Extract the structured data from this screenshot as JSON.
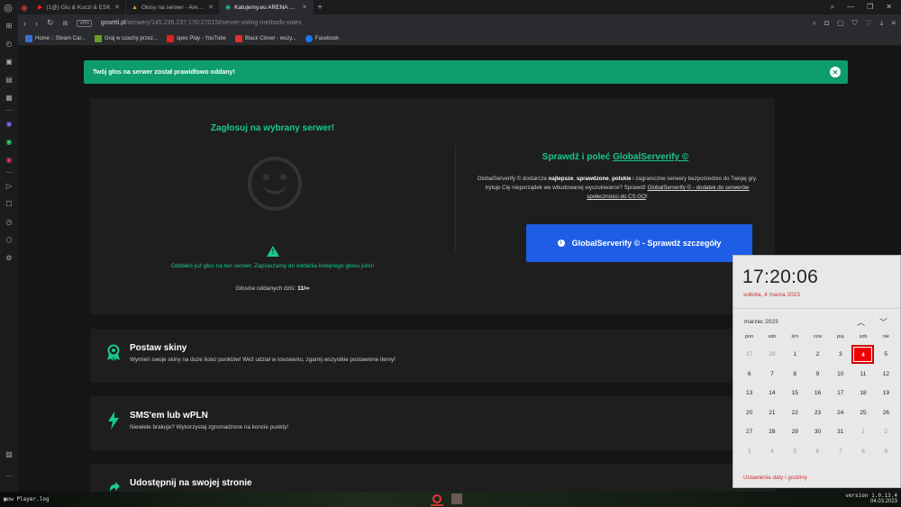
{
  "browser": {
    "tabs": [
      {
        "title": "(1@) Giu & Kuczi & ESK",
        "active": false
      },
      {
        "title": "Głosy na serwer - Arena 1v",
        "active": false
      },
      {
        "title": "Katujemy.eu ARENA 1v1 1",
        "active": true
      }
    ],
    "url_domain": "gosetti.pl",
    "url_path": "/serwery/145.239.237.170:27015#server-voting-methods-votes",
    "vpn_label": "VPN",
    "bookmarks": [
      {
        "label": "Home :: Steam Car...",
        "color": "#3a6fd1"
      },
      {
        "label": "Graj w szachy przez...",
        "color": "#6a9a2a"
      },
      {
        "label": "spec Play - YouTube",
        "color": "#e02020"
      },
      {
        "label": "Black Clover - wszy...",
        "color": "#e03030"
      },
      {
        "label": "Facebook",
        "color": "#1877f2"
      }
    ]
  },
  "alert": {
    "message": "Twój głos na serwer został prawidłowo oddany!",
    "close_glyph": "✕"
  },
  "vote_card": {
    "title": "Zagłosuj na wybrany serwer!",
    "voted_message": "Oddałeś już głos na ten serwer. Zapraszamy do oddania kolejnego głosu jutro!",
    "votes_label": "Głosów oddanych dziś:",
    "votes_value": "11/∞",
    "gs_title_prefix": "Sprawdź i poleć",
    "gs_title_link": "GlobalServerify ©",
    "gs_desc_1": "GlobalServerify © dostarcza",
    "gs_desc_b1": "najlepsze",
    "gs_desc_sep1": ",",
    "gs_desc_b2": "sprawdzone",
    "gs_desc_sep2": ",",
    "gs_desc_b3": "polskie",
    "gs_desc_2": "i zagraniczne serwery bezpośrednio do Twojej gry. Irytuje Cię nieporządek we wbudowanej wyszukiwarce? Sprawdź",
    "gs_desc_link": "GlobalServerify © - dodatek do serwerów społeczności do CS:GO",
    "gs_desc_end": "!",
    "gs_button": "GlobalServerify © - Sprawdź szczegóły"
  },
  "features": [
    {
      "title": "Postaw skiny",
      "desc": "Wymień swoje skiny na duże ilości punktów! Weź udział w losowaniu, zgarnij wszystkie postawione itemy!",
      "icon": "award-icon"
    },
    {
      "title": "SMS'em lub wPLN",
      "desc": "Niewiele brakuje? Wykorzystaj zgromadzone na koncie punkty!",
      "icon": "lightning-icon"
    },
    {
      "title": "Udostępnij na swojej stronie",
      "desc": "",
      "icon": "share-icon"
    }
  ],
  "calendar": {
    "time": "17:20:06",
    "date": "sobota, 4 marca 2023",
    "month": "marzec 2023",
    "weekdays": [
      "pon",
      "wto",
      "śro",
      "czw",
      "pią",
      "sob",
      "nie"
    ],
    "weeks": [
      [
        "27",
        "28",
        "1",
        "2",
        "3",
        "4",
        "5"
      ],
      [
        "6",
        "7",
        "8",
        "9",
        "10",
        "11",
        "12"
      ],
      [
        "13",
        "14",
        "15",
        "16",
        "17",
        "18",
        "19"
      ],
      [
        "20",
        "21",
        "22",
        "23",
        "24",
        "25",
        "26"
      ],
      [
        "27",
        "28",
        "29",
        "30",
        "31",
        "1",
        "2"
      ],
      [
        "3",
        "4",
        "5",
        "6",
        "7",
        "8",
        "9"
      ]
    ],
    "today": "4",
    "settings_link": "Ustawienia daty i godziny"
  },
  "taskbar": {
    "left_text": "▣ow Player.log",
    "version": "version 1.0.13.4",
    "date": "04.03.2023"
  }
}
